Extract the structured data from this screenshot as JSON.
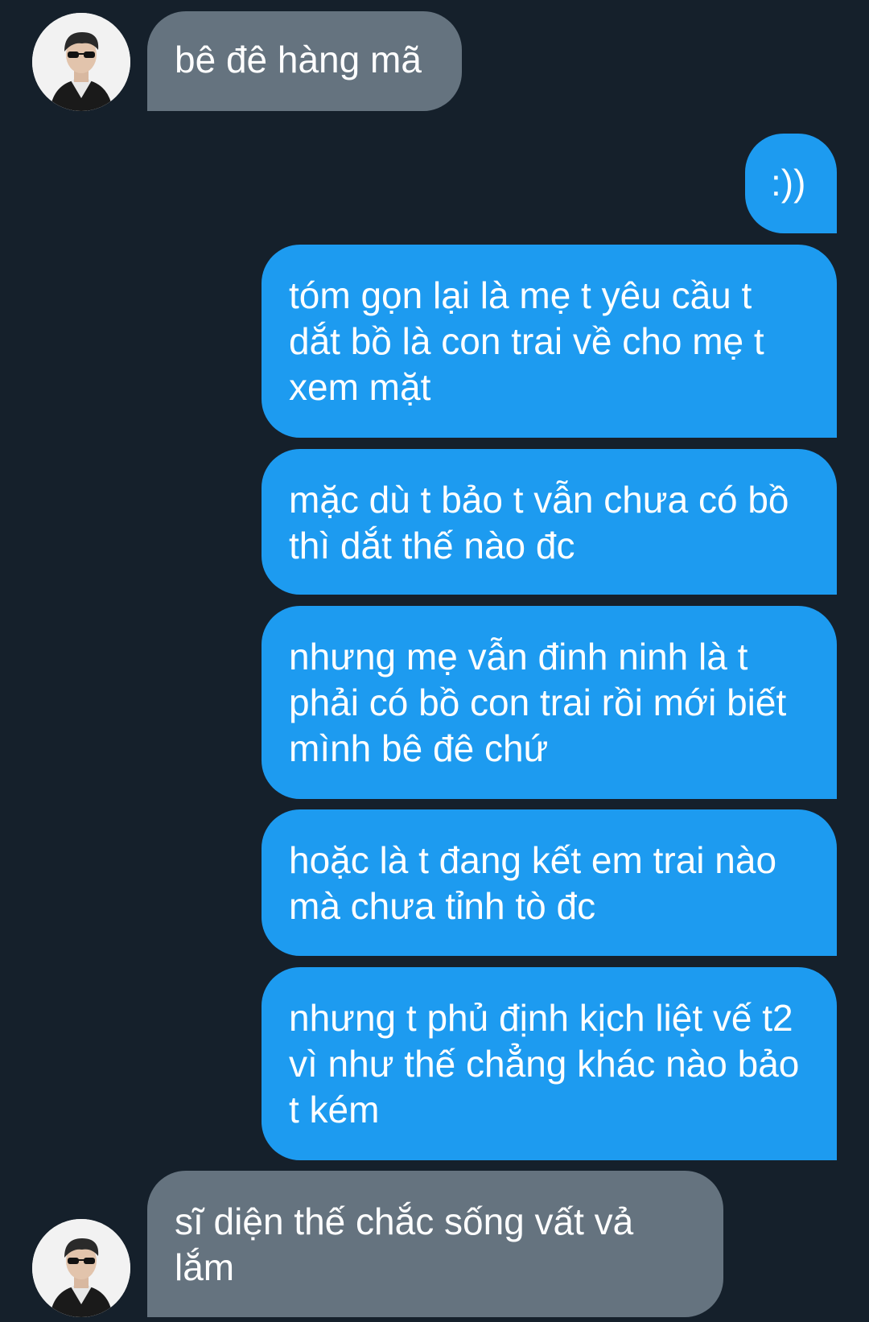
{
  "conversation": {
    "messages": [
      {
        "sender": "other",
        "text": "bê đê hàng mã"
      },
      {
        "sender": "me",
        "text": ":))"
      },
      {
        "sender": "me",
        "text": "tóm gọn lại là mẹ t yêu cầu t dắt bồ là con trai về cho mẹ t xem mặt"
      },
      {
        "sender": "me",
        "text": "mặc dù t bảo t vẫn chưa có bồ thì dắt thế nào đc"
      },
      {
        "sender": "me",
        "text": "nhưng mẹ vẫn đinh ninh là t phải có bồ con trai rồi mới biết mình bê đê chứ"
      },
      {
        "sender": "me",
        "text": "hoặc là t đang kết em trai nào mà chưa tỉnh tò đc"
      },
      {
        "sender": "me",
        "text": "nhưng t phủ định kịch liệt vế t2 vì như thế chẳng khác nào bảo t kém"
      },
      {
        "sender": "other",
        "text": "sĩ diện thế chắc sống vất vả lắm"
      }
    ]
  },
  "colors": {
    "background": "#15202b",
    "incoming_bubble": "#65737f",
    "outgoing_bubble": "#1d9bf0",
    "text": "#ffffff"
  },
  "icons": {
    "avatar": "profile-avatar-photo"
  }
}
